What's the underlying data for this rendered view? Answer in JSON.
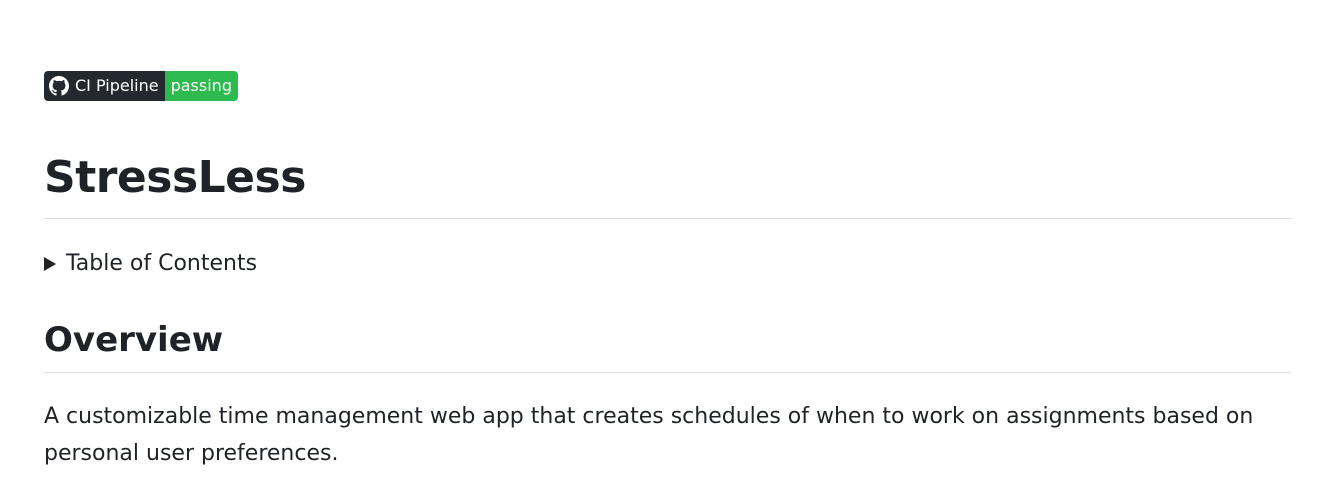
{
  "badge": {
    "label": "CI Pipeline",
    "status": "passing",
    "icon": "github-icon",
    "colors": {
      "label_bg": "#24292f",
      "status_bg": "#2dba4e"
    }
  },
  "title": "StressLess",
  "toc": {
    "label": "Table of Contents",
    "icon": "triangle-right-icon"
  },
  "overview": {
    "heading": "Overview",
    "text": "A customizable time management web app that creates schedules of when to work on assignments based on personal user preferences."
  }
}
